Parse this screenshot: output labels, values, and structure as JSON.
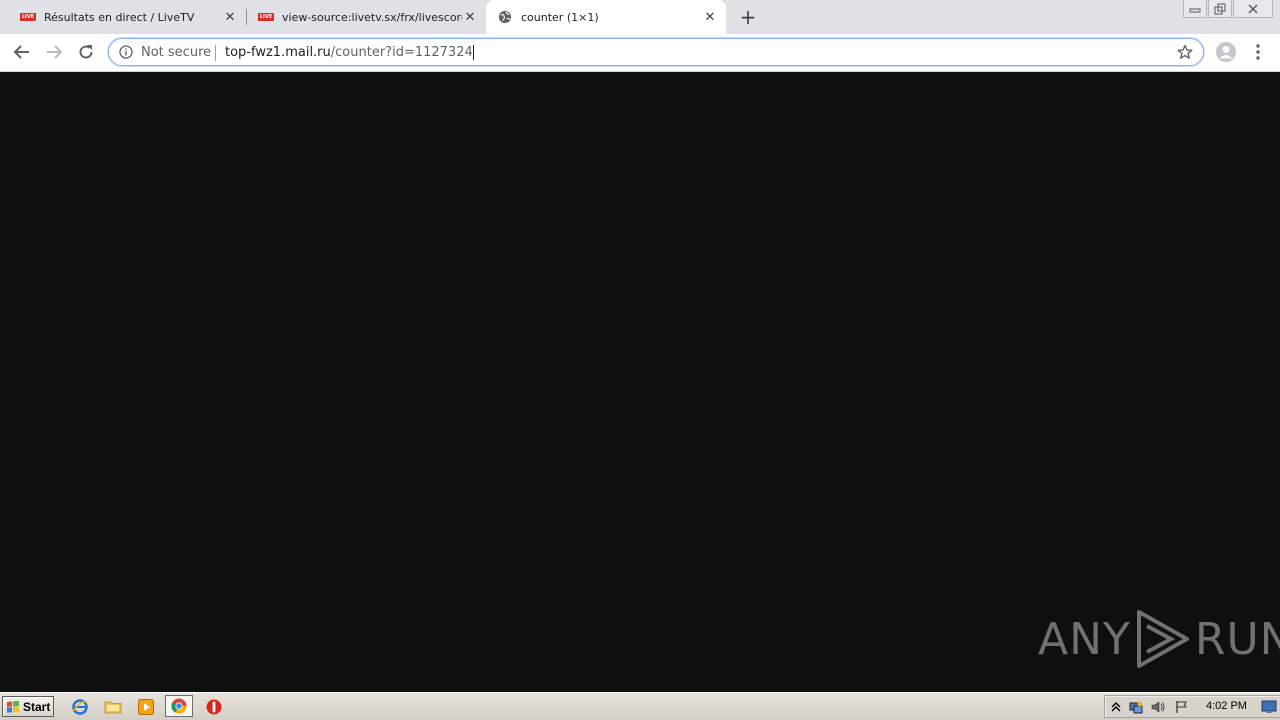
{
  "browser": {
    "tabs": [
      {
        "title": "Résultats en direct / LiveTV",
        "favicon": "live-icon",
        "favicon_text": "LIVE",
        "active": false
      },
      {
        "title": "view-source:livetv.sx/frx/livescore/",
        "favicon": "live-icon",
        "favicon_text": "LIVE",
        "active": false
      },
      {
        "title": "counter (1×1)",
        "favicon": "globe-icon",
        "active": true
      }
    ],
    "omnibox": {
      "security_label": "Not secure",
      "url_host": "top-fwz1.mail.ru",
      "url_path": "/counter?id=1127324"
    }
  },
  "watermark": {
    "left_text": "ANY",
    "right_text": "RUN"
  },
  "taskbar": {
    "start_label": "Start",
    "clock": "4:02 PM",
    "apps": [
      "internet-explorer-icon",
      "folder-icon",
      "media-player-icon",
      "chrome-icon",
      "stop-icon"
    ]
  },
  "colors": {
    "page_background": "#0f0f0f",
    "tab_strip": "#dee1e6",
    "live_badge": "#d93025",
    "omnibox_focus": "#8ab4f8"
  }
}
